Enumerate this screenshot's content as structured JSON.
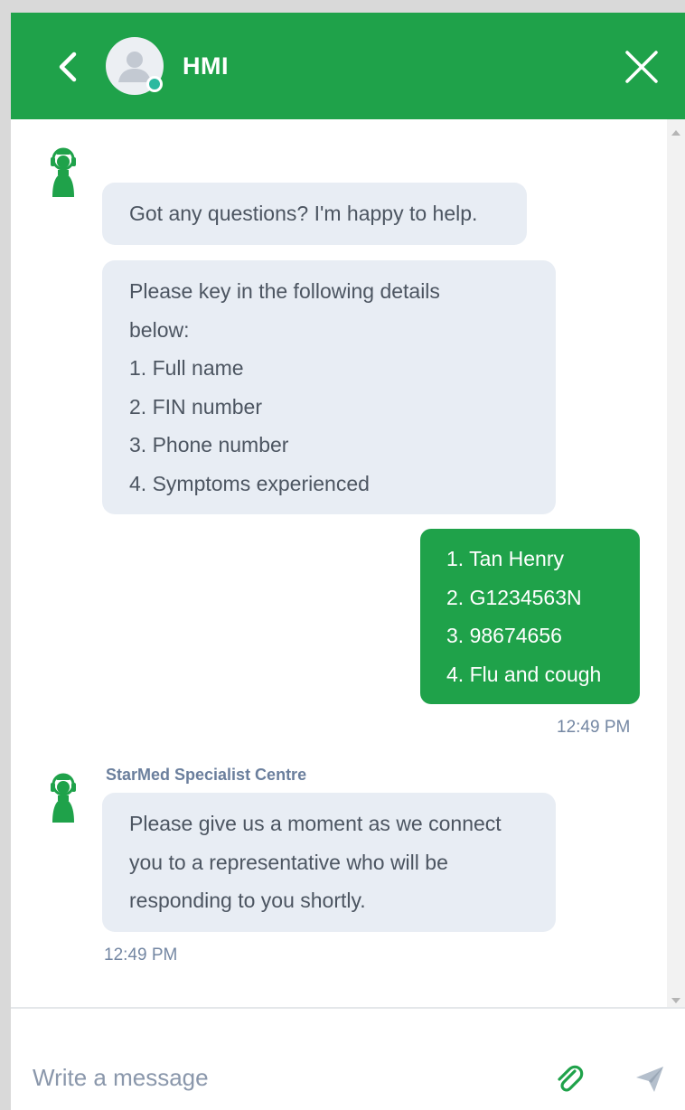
{
  "header": {
    "title": "HMI",
    "back_icon": "chevron-left-icon",
    "close_icon": "close-icon",
    "avatar_icon": "user-avatar-icon",
    "background": "#1fa24a",
    "online_color": "#2bb9a0"
  },
  "messages": [
    {
      "from": "bot",
      "lines": [
        "Got any questions? I'm happy to help."
      ]
    },
    {
      "from": "bot",
      "lines": [
        "Please key in the following details",
        "below:",
        "1. Full name",
        "2. FIN number",
        "3. Phone number",
        "4. Symptoms experienced"
      ]
    },
    {
      "from": "user",
      "lines": [
        "1. Tan Henry",
        "2. G1234563N",
        "3. 98674656",
        "4. Flu and cough"
      ],
      "time": "12:49 PM"
    },
    {
      "from": "bot",
      "sender": "StarMed Specialist Centre",
      "lines": [
        "Please give us a moment as we connect",
        "you to a representative who will be",
        "responding to you shortly."
      ],
      "time": "12:49 PM"
    }
  ],
  "composer": {
    "placeholder": "Write a message",
    "attach_icon": "paperclip-icon",
    "send_icon": "send-icon"
  },
  "colors": {
    "accent": "#1fa24a",
    "bot_bubble": "#e8edf4",
    "bot_text": "#4c5561",
    "timestamp": "#7487a3"
  }
}
